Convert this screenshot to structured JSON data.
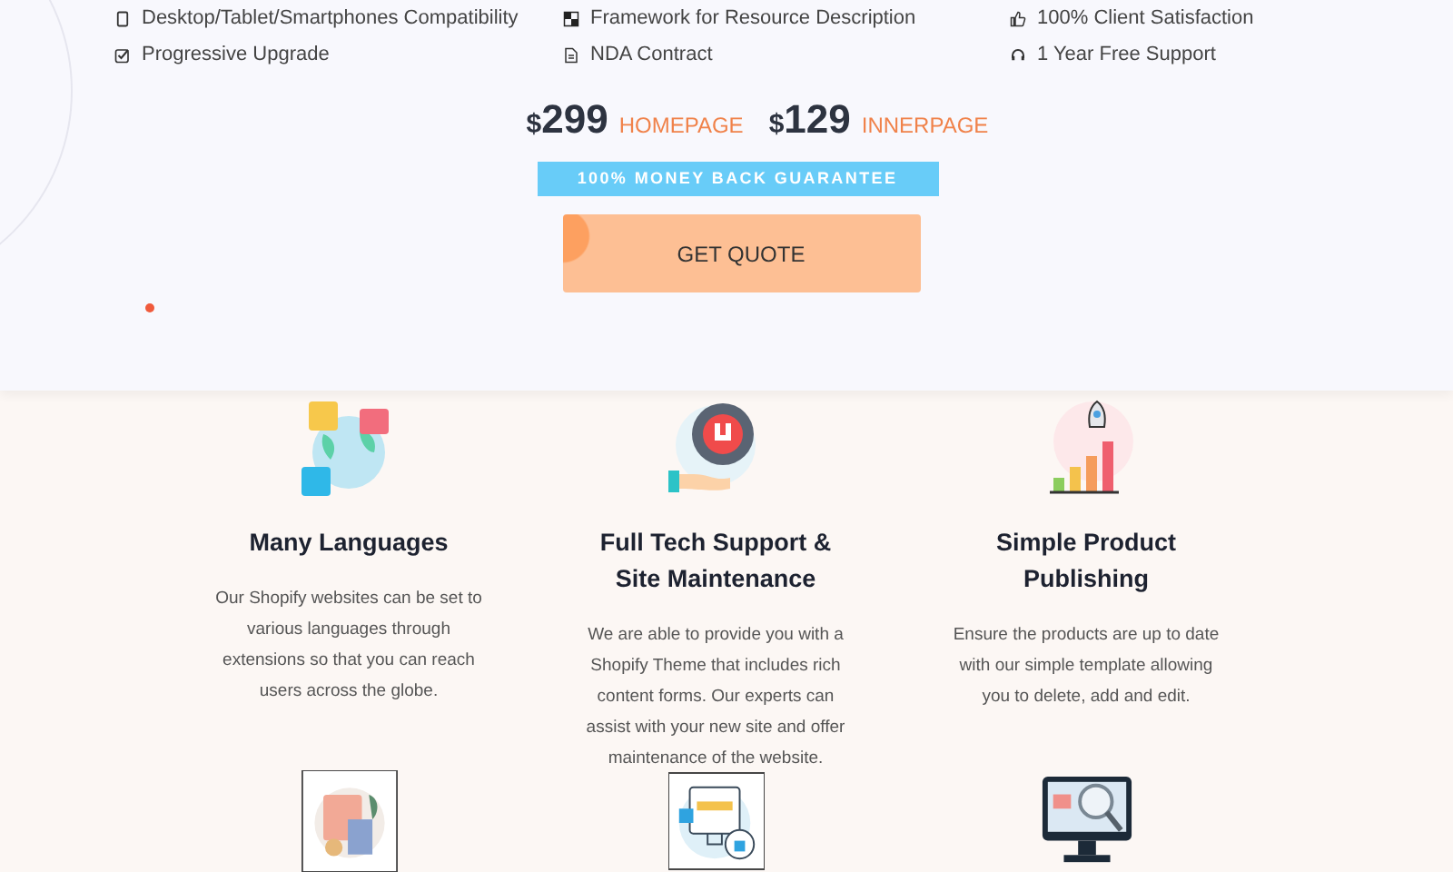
{
  "features": [
    {
      "kind": "mobile",
      "text": "Desktop/Tablet/Smartphones Compatibility"
    },
    {
      "kind": "grid",
      "text": "Framework for Resource Description"
    },
    {
      "kind": "thumb",
      "text": "100% Client Satisfaction"
    },
    {
      "kind": "check",
      "text": "Progressive Upgrade"
    },
    {
      "kind": "doc",
      "text": "NDA Contract"
    },
    {
      "kind": "headset",
      "text": "1 Year Free Support"
    }
  ],
  "prices": [
    {
      "currency": "$",
      "amount": "299",
      "label": "HOMEPAGE"
    },
    {
      "currency": "$",
      "amount": "129",
      "label": "INNERPAGE"
    }
  ],
  "guarantee": "100% MONEY BACK GUARANTEE",
  "quote_button": "GET QUOTE",
  "cards": [
    {
      "kind": "globe",
      "title": "Many Languages",
      "text": "Our Shopify websites can be set to various languages through extensions so that you can reach users across the globe."
    },
    {
      "kind": "gear",
      "title": "Full Tech Support & Site Maintenance",
      "text": "We are able to provide you with a Shopify Theme that includes rich content forms. Our experts can assist with your new site and offer maintenance of the website."
    },
    {
      "kind": "chart",
      "title": "Simple Product Publishing",
      "text": "Ensure the products are up to date with our simple template allowing you to delete, add and edit."
    }
  ],
  "next_cards": [
    {
      "kind": "documents"
    },
    {
      "kind": "rating"
    },
    {
      "kind": "monitor"
    }
  ]
}
